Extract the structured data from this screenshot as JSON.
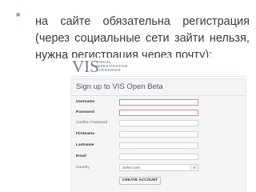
{
  "slide": {
    "bullet_symbol": "■",
    "line1_words": [
      "на",
      "сайте",
      "обязательна",
      "регистрация"
    ],
    "line2_words": [
      "(через",
      "социальные",
      "сети",
      "зайти",
      "нельзя,"
    ],
    "line3": "нужна регистрация через почту):"
  },
  "screenshot": {
    "logo": {
      "mark": "VIS",
      "line1": "VISUAL",
      "line2": "INVESTIGATIVE",
      "line3": "SCENARIOS"
    },
    "form_title": "Sign up to VIS Open Beta",
    "fields": [
      {
        "label": "Username",
        "required": true
      },
      {
        "label": "Password",
        "required": true
      },
      {
        "label": "Confirm Password",
        "required": false
      },
      {
        "label": "Firstname",
        "required": false
      },
      {
        "label": "Lastname",
        "required": false
      },
      {
        "label": "Email",
        "required": false
      }
    ],
    "country": {
      "label": "Country",
      "selected": "Select one"
    },
    "submit_label": "CREATE ACCOUNT",
    "colors": {
      "required_border": "#e08080",
      "panel_bg": "#f3f4f6"
    }
  }
}
